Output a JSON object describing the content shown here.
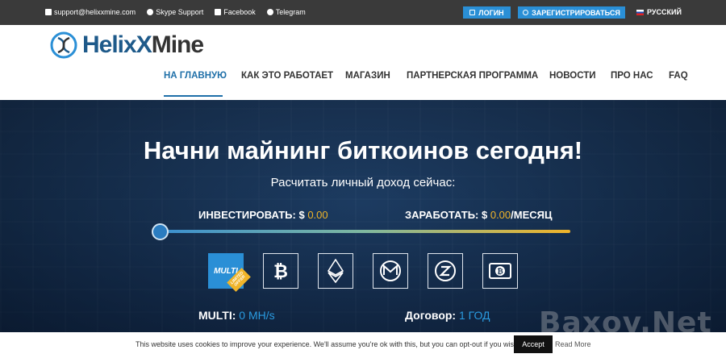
{
  "topbar": {
    "email": "support@helixxmine.com",
    "skype": "Skype Support",
    "facebook": "Facebook",
    "telegram": "Telegram",
    "login": "ЛОГИН",
    "register": "ЗАРЕГИСТРИРОВАТЬСЯ",
    "language": "РУССКИЙ"
  },
  "logo": {
    "part1": "Helix",
    "part2": "X",
    "part3": "Mine"
  },
  "nav": [
    "НА ГЛАВНУЮ",
    "КАК ЭТО РАБОТАЕТ",
    "МАГАЗИН",
    "ПАРТНЕРСКАЯ ПРОГРАММА",
    "НОВОСТИ",
    "ПРО НАС",
    "FAQ"
  ],
  "hero": {
    "title": "Начни майнинг биткоинов сегодня!",
    "subtitle": "Расчитать личный доход сейчас:",
    "invest_label": "ИНВЕСТИРОВАТЬ: $ ",
    "invest_value": "0.00",
    "earn_label": "ЗАРАБОТАТЬ: $ ",
    "earn_value": "0.00",
    "earn_unit": "/МЕСЯЦ",
    "multi_label": "MULTI: ",
    "multi_value": "0 MH/s",
    "contract_label": "Договор: ",
    "contract_value": "1 ГОД"
  },
  "coins": {
    "multi": "MULTI",
    "badge": "LIMITED OFFER",
    "bitcoin": "bitcoin-icon",
    "ethereum": "ethereum-icon",
    "monero": "monero-icon",
    "zcash": "zcash-icon",
    "bitcoin_cash": "bitcoin-cash-icon"
  },
  "cookie": {
    "text": "This website uses cookies to improve your experience. We'll assume you're ok with this, but you can opt-out if you wish.",
    "accept": "Accept",
    "read_more": "Read More"
  },
  "watermark": "Baxov.Net"
}
